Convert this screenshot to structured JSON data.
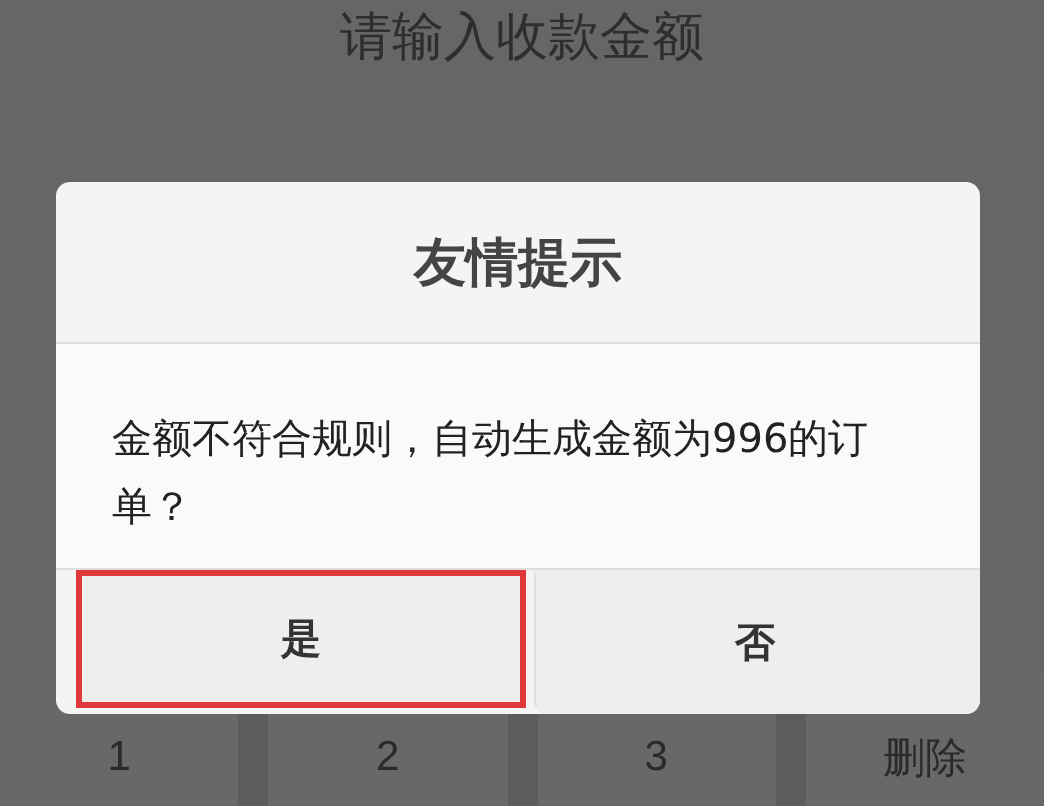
{
  "header": {
    "title": "请输入收款金额"
  },
  "keypad": [
    {
      "label": "1"
    },
    {
      "label": "2"
    },
    {
      "label": "3"
    },
    {
      "label": "删除"
    }
  ],
  "dialog": {
    "title": "友情提示",
    "message": "金额不符合规则，自动生成金额为996的订单？",
    "buttons": [
      {
        "label": "是",
        "highlighted": true
      },
      {
        "label": "否",
        "highlighted": false
      }
    ]
  }
}
